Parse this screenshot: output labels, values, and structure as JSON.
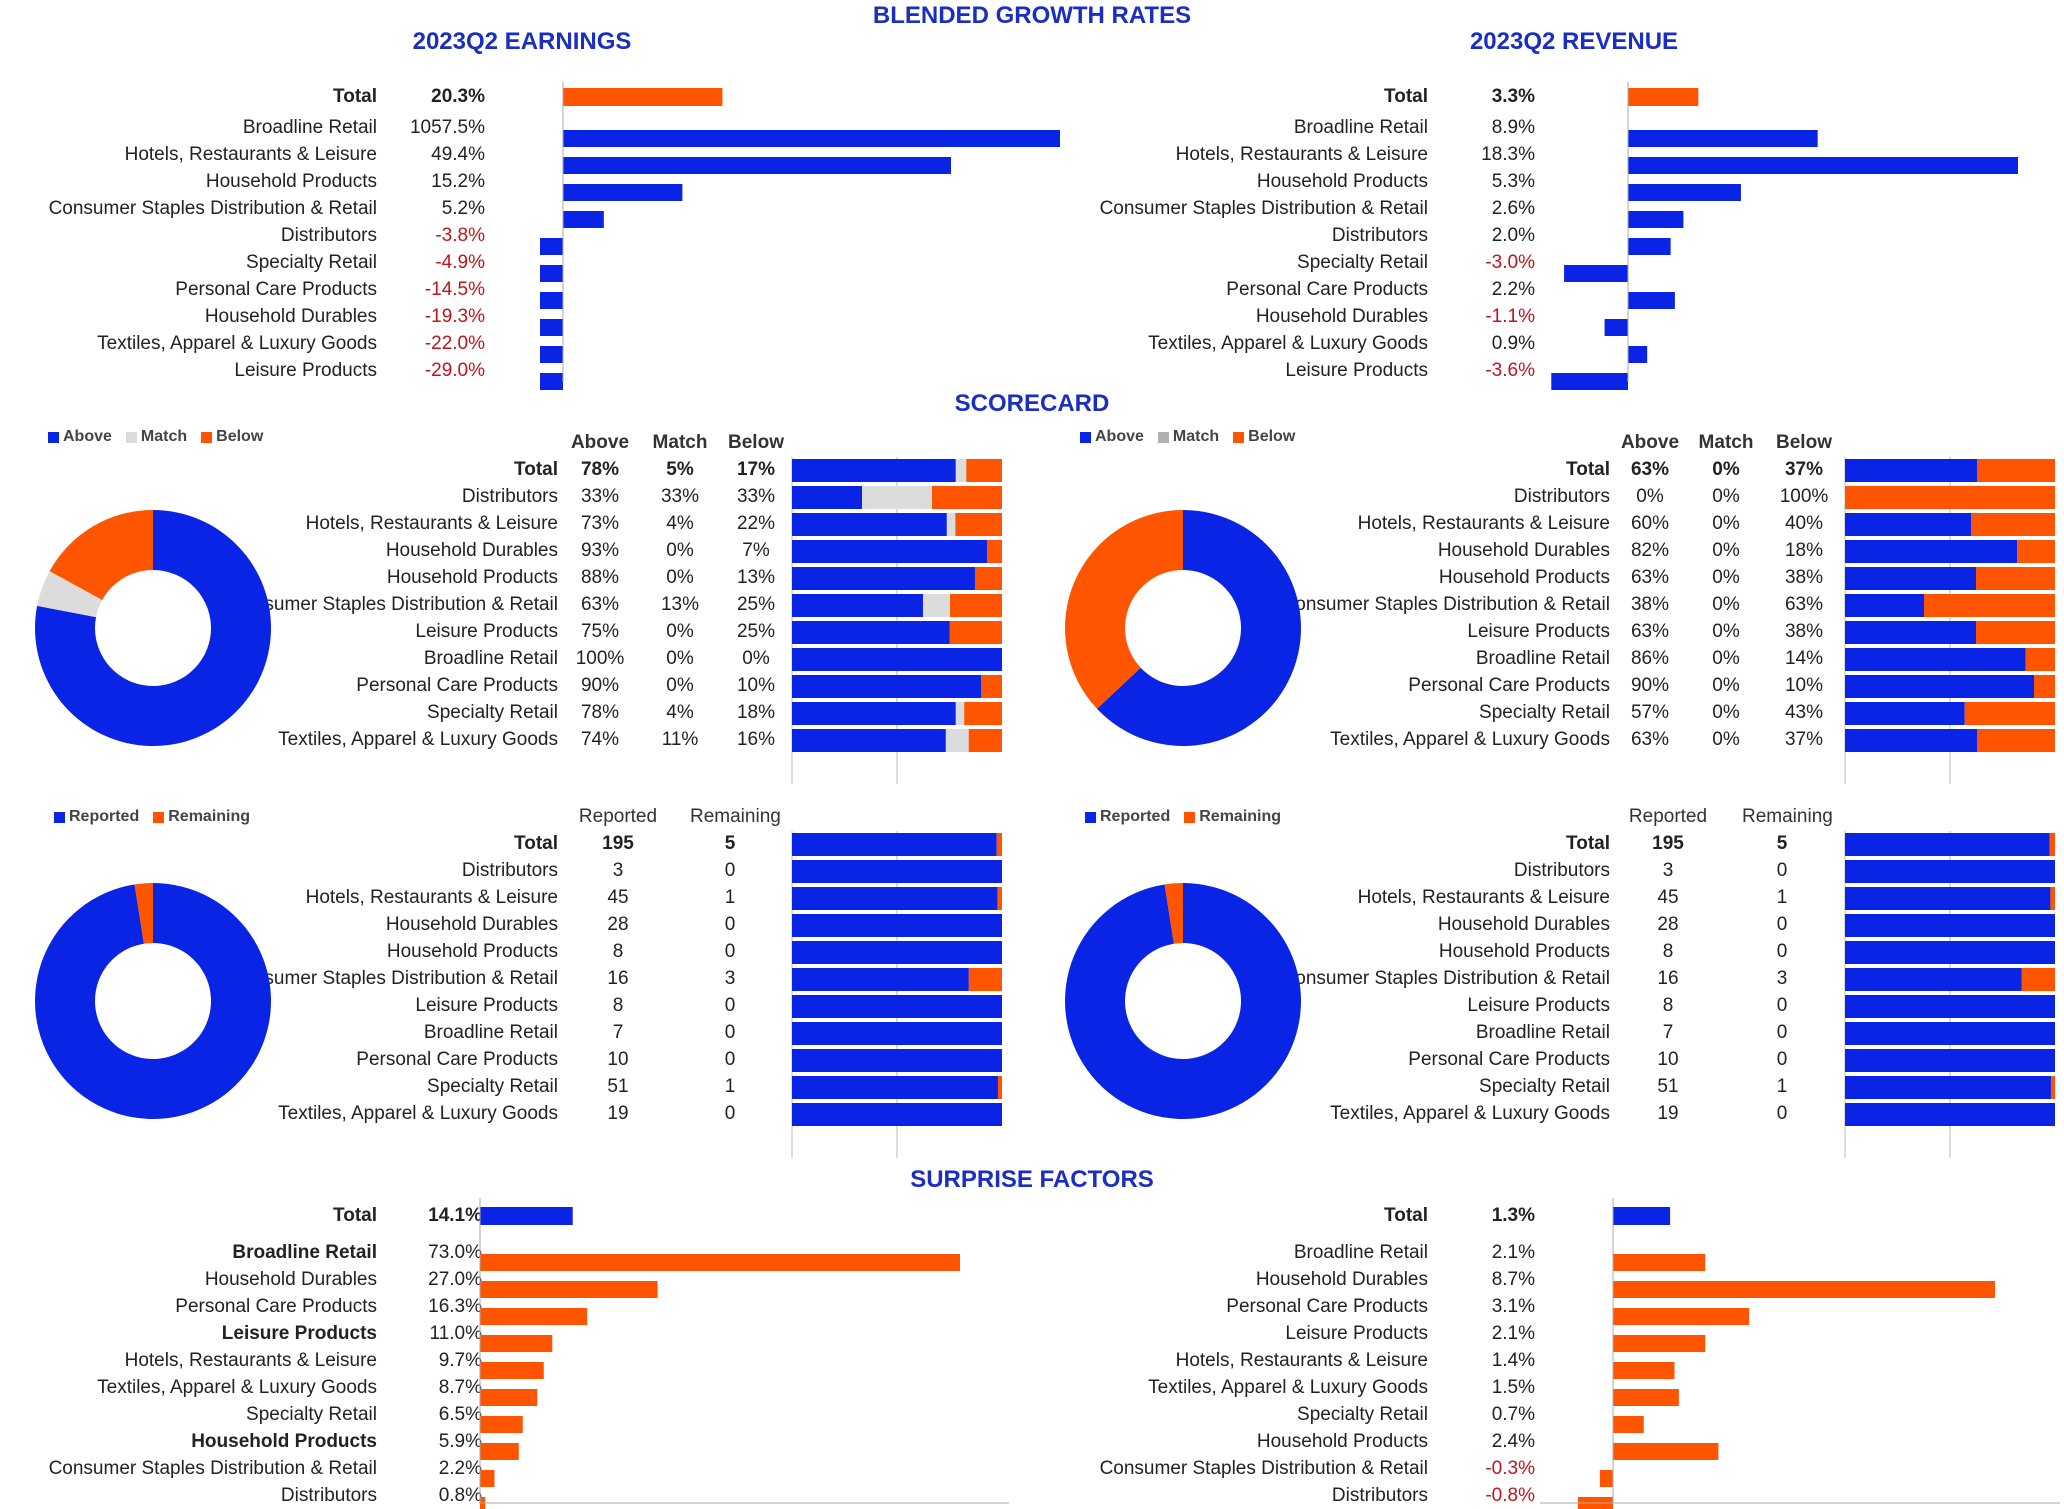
{
  "colors": {
    "blue": "#0a24e6",
    "orange": "#ff5500",
    "grey": "#dcdcdc",
    "grey2": "#b0b0b0",
    "title": "#1a2fc2",
    "neg": "#c0141c",
    "axis": "#aaaaaa"
  },
  "title": "BLENDED GROWTH RATES",
  "scorecard_title": "SCORECARD",
  "surprise_title": "SURPRISE FACTORS",
  "chart_data": [
    {
      "id": "earnings_growth",
      "type": "bar",
      "orientation": "horizontal",
      "title": "2023Q2 EARNINGS",
      "total": {
        "label": "Total",
        "value": 20.3,
        "display": "20.3%"
      },
      "categories": [
        "Broadline Retail",
        "Hotels, Restaurants & Leisure",
        "Household Products",
        "Consumer Staples Distribution & Retail",
        "Distributors",
        "Specialty Retail",
        "Personal Care Products",
        "Household Durables",
        "Textiles, Apparel & Luxury Goods",
        "Leisure Products"
      ],
      "values": [
        1057.5,
        49.4,
        15.2,
        5.2,
        -3.8,
        -4.9,
        -14.5,
        -19.3,
        -22.0,
        -29.0
      ],
      "display": [
        "1057.5%",
        "49.4%",
        "15.2%",
        "5.2%",
        "-3.8%",
        "-4.9%",
        "-14.5%",
        "-19.3%",
        "-22.0%",
        "-29.0%"
      ]
    },
    {
      "id": "revenue_growth",
      "type": "bar",
      "orientation": "horizontal",
      "title": "2023Q2 REVENUE",
      "total": {
        "label": "Total",
        "value": 3.3,
        "display": "3.3%"
      },
      "categories": [
        "Broadline Retail",
        "Hotels, Restaurants & Leisure",
        "Household Products",
        "Consumer Staples Distribution & Retail",
        "Distributors",
        "Specialty Retail",
        "Personal Care Products",
        "Household Durables",
        "Textiles, Apparel & Luxury Goods",
        "Leisure Products"
      ],
      "values": [
        8.9,
        18.3,
        5.3,
        2.6,
        2.0,
        -3.0,
        2.2,
        -1.1,
        0.9,
        -3.6
      ],
      "display": [
        "8.9%",
        "18.3%",
        "5.3%",
        "2.6%",
        "2.0%",
        "-3.0%",
        "2.2%",
        "-1.1%",
        "0.9%",
        "-3.6%"
      ]
    },
    {
      "id": "earnings_scorecard",
      "type": "bar",
      "stacked": true,
      "legend": [
        "Above",
        "Match",
        "Below"
      ],
      "columns": [
        "Above",
        "Match",
        "Below"
      ],
      "total": {
        "label": "Total",
        "values": [
          78,
          5,
          17
        ]
      },
      "categories": [
        "Distributors",
        "Hotels, Restaurants & Leisure",
        "Household Durables",
        "Household Products",
        "Consumer Staples Distribution & Retail",
        "Leisure Products",
        "Broadline Retail",
        "Personal Care Products",
        "Specialty Retail",
        "Textiles, Apparel & Luxury Goods"
      ],
      "series": [
        {
          "name": "Above",
          "values": [
            33,
            73,
            93,
            88,
            63,
            75,
            100,
            90,
            78,
            74
          ]
        },
        {
          "name": "Match",
          "values": [
            33,
            4,
            0,
            0,
            13,
            0,
            0,
            0,
            4,
            11
          ]
        },
        {
          "name": "Below",
          "values": [
            33,
            22,
            7,
            13,
            25,
            25,
            0,
            10,
            18,
            16
          ]
        }
      ],
      "donut": {
        "type": "pie",
        "values": [
          78,
          5,
          17
        ],
        "labels": [
          "Above",
          "Match",
          "Below"
        ]
      }
    },
    {
      "id": "revenue_scorecard",
      "type": "bar",
      "stacked": true,
      "legend": [
        "Above",
        "Match",
        "Below"
      ],
      "columns": [
        "Above",
        "Match",
        "Below"
      ],
      "total": {
        "label": "Total",
        "values": [
          63,
          0,
          37
        ]
      },
      "categories": [
        "Distributors",
        "Hotels, Restaurants & Leisure",
        "Household Durables",
        "Household Products",
        "Consumer Staples Distribution & Retail",
        "Leisure Products",
        "Broadline Retail",
        "Personal Care Products",
        "Specialty Retail",
        "Textiles, Apparel & Luxury Goods"
      ],
      "series": [
        {
          "name": "Above",
          "values": [
            0,
            60,
            82,
            63,
            38,
            63,
            86,
            90,
            57,
            63
          ]
        },
        {
          "name": "Match",
          "values": [
            0,
            0,
            0,
            0,
            0,
            0,
            0,
            0,
            0,
            0
          ]
        },
        {
          "name": "Below",
          "values": [
            100,
            40,
            18,
            38,
            63,
            38,
            14,
            10,
            43,
            37
          ]
        }
      ],
      "donut": {
        "type": "pie",
        "values": [
          63,
          0,
          37
        ],
        "labels": [
          "Above",
          "Match",
          "Below"
        ]
      }
    },
    {
      "id": "earnings_reported",
      "type": "bar",
      "stacked": true,
      "legend": [
        "Reported",
        "Remaining"
      ],
      "columns": [
        "Reported",
        "Remaining"
      ],
      "total": {
        "label": "Total",
        "values": [
          195,
          5
        ]
      },
      "categories": [
        "Distributors",
        "Hotels, Restaurants & Leisure",
        "Household Durables",
        "Household Products",
        "Consumer Staples Distribution & Retail",
        "Leisure Products",
        "Broadline Retail",
        "Personal Care Products",
        "Specialty Retail",
        "Textiles, Apparel & Luxury Goods"
      ],
      "series": [
        {
          "name": "Reported",
          "values": [
            3,
            45,
            28,
            8,
            16,
            8,
            7,
            10,
            51,
            19
          ]
        },
        {
          "name": "Remaining",
          "values": [
            0,
            1,
            0,
            0,
            3,
            0,
            0,
            0,
            1,
            0
          ]
        }
      ],
      "donut": {
        "type": "pie",
        "values": [
          195,
          5
        ],
        "labels": [
          "Reported",
          "Remaining"
        ]
      }
    },
    {
      "id": "revenue_reported",
      "type": "bar",
      "stacked": true,
      "legend": [
        "Reported",
        "Remaining"
      ],
      "columns": [
        "Reported",
        "Remaining"
      ],
      "total": {
        "label": "Total",
        "values": [
          195,
          5
        ]
      },
      "categories": [
        "Distributors",
        "Hotels, Restaurants & Leisure",
        "Household Durables",
        "Household Products",
        "Consumer Staples Distribution & Retail",
        "Leisure Products",
        "Broadline Retail",
        "Personal Care Products",
        "Specialty Retail",
        "Textiles, Apparel & Luxury Goods"
      ],
      "series": [
        {
          "name": "Reported",
          "values": [
            3,
            45,
            28,
            8,
            16,
            8,
            7,
            10,
            51,
            19
          ]
        },
        {
          "name": "Remaining",
          "values": [
            0,
            1,
            0,
            0,
            3,
            0,
            0,
            0,
            1,
            0
          ]
        }
      ],
      "donut": {
        "type": "pie",
        "values": [
          195,
          5
        ],
        "labels": [
          "Reported",
          "Remaining"
        ]
      }
    },
    {
      "id": "earnings_surprise",
      "type": "bar",
      "orientation": "horizontal",
      "total": {
        "label": "Total",
        "value": 14.1,
        "display": "14.1%"
      },
      "categories": [
        "Broadline Retail",
        "Household Durables",
        "Personal Care Products",
        "Leisure Products",
        "Hotels, Restaurants & Leisure",
        "Textiles, Apparel & Luxury Goods",
        "Specialty Retail",
        "Household Products",
        "Consumer Staples Distribution & Retail",
        "Distributors"
      ],
      "bold": [
        true,
        false,
        false,
        true,
        false,
        false,
        false,
        true,
        false,
        false
      ],
      "values": [
        73.0,
        27.0,
        16.3,
        11.0,
        9.7,
        8.7,
        6.5,
        5.9,
        2.2,
        0.8
      ],
      "display": [
        "73.0%",
        "27.0%",
        "16.3%",
        "11.0%",
        "9.7%",
        "8.7%",
        "6.5%",
        "5.9%",
        "2.2%",
        "0.8%"
      ]
    },
    {
      "id": "revenue_surprise",
      "type": "bar",
      "orientation": "horizontal",
      "total": {
        "label": "Total",
        "value": 1.3,
        "display": "1.3%"
      },
      "categories": [
        "Broadline Retail",
        "Household Durables",
        "Personal Care Products",
        "Leisure Products",
        "Hotels, Restaurants & Leisure",
        "Textiles, Apparel & Luxury Goods",
        "Specialty Retail",
        "Household Products",
        "Consumer Staples Distribution & Retail",
        "Distributors"
      ],
      "bold": [
        false,
        false,
        false,
        false,
        false,
        false,
        false,
        false,
        false,
        false
      ],
      "values": [
        2.1,
        8.7,
        3.1,
        2.1,
        1.4,
        1.5,
        0.7,
        2.4,
        -0.3,
        -0.8
      ],
      "display": [
        "2.1%",
        "8.7%",
        "3.1%",
        "2.1%",
        "1.4%",
        "1.5%",
        "0.7%",
        "2.4%",
        "-0.3%",
        "-0.8%"
      ]
    }
  ]
}
